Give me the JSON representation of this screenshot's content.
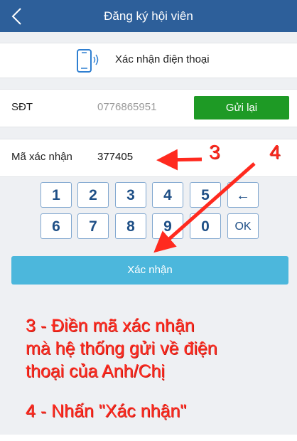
{
  "header": {
    "title": "Đăng ký hội viên",
    "back_icon": "chevron-left-icon"
  },
  "verify_section": {
    "label": "Xác nhận điện thoại",
    "icon": "smartphone-icon"
  },
  "phone_row": {
    "label": "SĐT",
    "value": "0776865951",
    "resend_label": "Gửi lại"
  },
  "code_row": {
    "label": "Mã xác nhận",
    "value": "377405"
  },
  "keypad": {
    "row1": [
      "1",
      "2",
      "3",
      "4",
      "5",
      "←"
    ],
    "row2": [
      "6",
      "7",
      "8",
      "9",
      "0",
      "OK"
    ]
  },
  "confirm_button": {
    "label": "Xác nhận"
  },
  "annotations": {
    "marker3": "3",
    "marker4": "4",
    "step3_lines": [
      "3 - Điền mã xác nhận",
      "mà hệ thống gửi về điện",
      "thoại của Anh/Chị"
    ],
    "step4": "4 - Nhấn \"Xác nhận\""
  },
  "colors": {
    "header_bg": "#2d5f9a",
    "resend_bg": "#1e9a25",
    "confirm_bg": "#4cb7dc",
    "annotation_red": "#ff2a1f",
    "key_text": "#1e4f86"
  }
}
